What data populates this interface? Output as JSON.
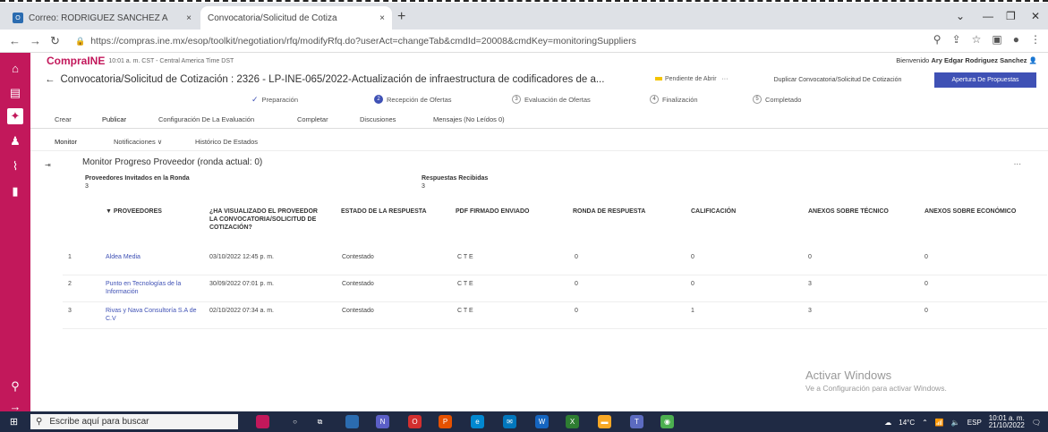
{
  "browser": {
    "tabs": [
      {
        "label": "Correo: RODRIGUEZ SANCHEZ A",
        "close": "×"
      },
      {
        "label": "Convocatoria/Solicitud de Cotiza",
        "close": "×"
      }
    ],
    "new_tab": "+",
    "url": "https://compras.ine.mx/esop/toolkit/negotiation/rfq/modifyRfq.do?userAct=changeTab&cmdId=20008&cmdKey=monitoringSuppliers"
  },
  "app": {
    "logo": "CompraINE",
    "time": "10:01 a. m. CST - Central America Time DST",
    "welcome_prefix": "Bienvenido",
    "user": "Ary Edgar Rodriguez Sanchez",
    "title": "Convocatoria/Solicitud de Cotización : 2326 - LP-INE-065/2022-Actualización de infraestructura de codificadores de a...",
    "status": "Pendiente de Abrir",
    "status_more": "···",
    "dup_button": "Duplicar Convocatoria/Solicitud De Cotización",
    "open_button": "Apertura De Propuestas",
    "status_color": "#f4c400",
    "accent": "#3f51b5",
    "brand": "#c2185b"
  },
  "stepper": [
    {
      "num": "✓",
      "label": "Preparación"
    },
    {
      "num": "2",
      "label": "Recepción de Ofertas"
    },
    {
      "num": "3",
      "label": "Evaluación de Ofertas"
    },
    {
      "num": "4",
      "label": "Finalización"
    },
    {
      "num": "5",
      "label": "Completado"
    }
  ],
  "tabs": [
    "Crear",
    "Publicar",
    "Configuración De La Evaluación",
    "Completar",
    "Discusiones",
    "Mensajes (No Leídos 0)"
  ],
  "subtabs": [
    "Monitor",
    "Notificaciones ∨",
    "Histórico De Estados"
  ],
  "monitor": {
    "title": "Monitor Progreso Proveedor (ronda actual: 0)",
    "more": "...",
    "invited_label": "Proveedores Invitados en la Ronda",
    "invited_value": "3",
    "received_label": "Respuestas Recibidas",
    "received_value": "3",
    "headers": [
      "▼ PROVEEDORES",
      "¿HA VISUALIZADO EL PROVEEDOR LA CONVOCATORIA/SOLICITUD DE COTIZACIÓN?",
      "ESTADO DE LA RESPUESTA",
      "PDF FIRMADO ENVIADO",
      "RONDA DE RESPUESTA",
      "CALIFICACIÓN",
      "ANEXOS SOBRE TÉCNICO",
      "ANEXOS SOBRE ECONÓMICO"
    ],
    "rows": [
      {
        "n": "1",
        "supplier": "Aldea Media",
        "viewed": "03/10/2022 12:45 p. m.",
        "state": "Contestado",
        "pdf": "C T E",
        "round": "0",
        "score": "0",
        "tech": "0",
        "econ": "0"
      },
      {
        "n": "2",
        "supplier": "Punto en Tecnologías de la Información",
        "viewed": "30/09/2022 07:01 p. m.",
        "state": "Contestado",
        "pdf": "C T E",
        "round": "0",
        "score": "0",
        "tech": "3",
        "econ": "0"
      },
      {
        "n": "3",
        "supplier": "Rivas y Nava Consultoría S.A de C.V",
        "viewed": "02/10/2022 07:34 a. m.",
        "state": "Contestado",
        "pdf": "C T E",
        "round": "0",
        "score": "1",
        "tech": "3",
        "econ": "0"
      }
    ]
  },
  "watermark": {
    "line1": "Activar Windows",
    "line2": "Ve a Configuración para activar Windows."
  },
  "taskbar": {
    "search_placeholder": "Escribe aquí para buscar",
    "weather": "14°C",
    "lang": "ESP",
    "time": "10:01 a. m.",
    "date": "21/10/2022"
  }
}
